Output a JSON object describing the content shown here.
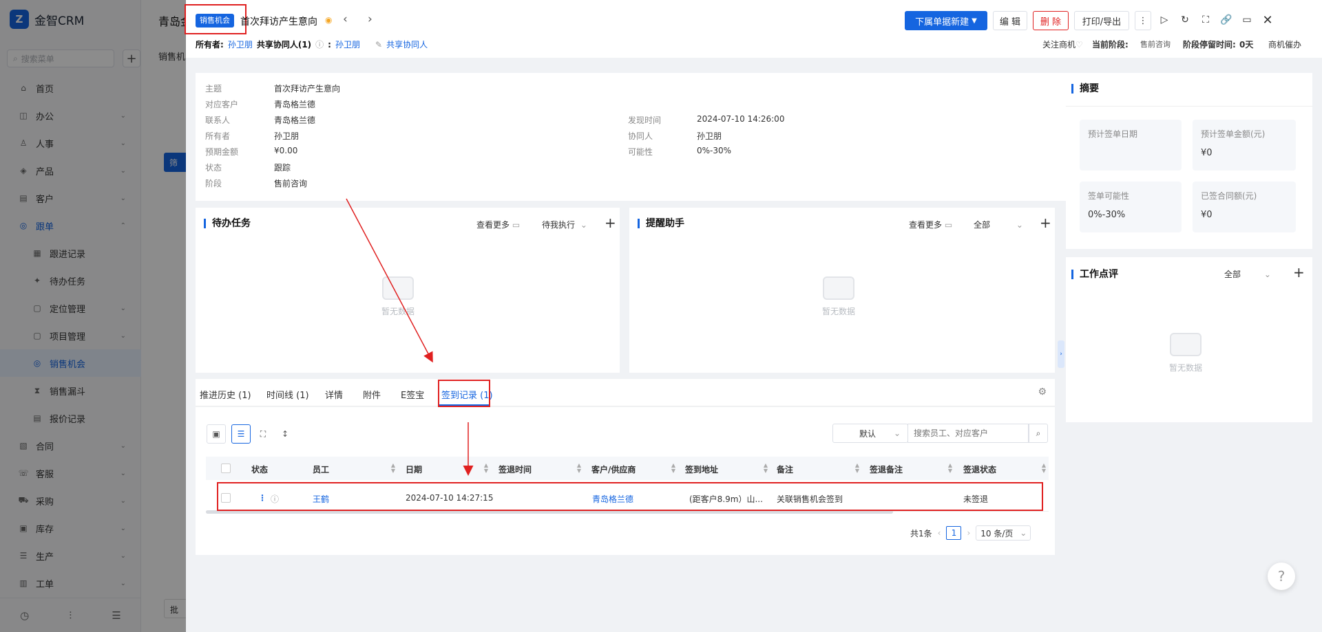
{
  "app": {
    "name": "金智CRM",
    "search_placeholder": "搜索菜单"
  },
  "nav": [
    {
      "label": "首页",
      "icon": "home-icon"
    },
    {
      "label": "办公",
      "icon": "office-icon"
    },
    {
      "label": "人事",
      "icon": "people-icon"
    },
    {
      "label": "产品",
      "icon": "cube-icon"
    },
    {
      "label": "客户",
      "icon": "customer-icon"
    },
    {
      "label": "跟单",
      "icon": "target-icon"
    },
    {
      "label": "跟进记录",
      "icon": "record-icon"
    },
    {
      "label": "待办任务",
      "icon": "pin-icon"
    },
    {
      "label": "定位管理",
      "icon": "location-icon"
    },
    {
      "label": "项目管理",
      "icon": "project-icon"
    },
    {
      "label": "销售机会",
      "icon": "opportunity-icon"
    },
    {
      "label": "销售漏斗",
      "icon": "funnel-icon"
    },
    {
      "label": "报价记录",
      "icon": "quote-icon"
    },
    {
      "label": "合同",
      "icon": "contract-icon"
    },
    {
      "label": "客服",
      "icon": "service-icon"
    },
    {
      "label": "采购",
      "icon": "purchase-icon"
    },
    {
      "label": "库存",
      "icon": "inventory-icon"
    },
    {
      "label": "生产",
      "icon": "production-icon"
    },
    {
      "label": "工单",
      "icon": "ticket-icon"
    }
  ],
  "bg_page": {
    "title": "青岛金",
    "tab": "销售机",
    "filter_btn": "筛",
    "batch_btn": "批"
  },
  "header": {
    "tag": "销售机会",
    "title": "首次拜访产生意向",
    "new_btn": "下属单据新建",
    "edit_btn": "编 辑",
    "delete_btn": "删 除",
    "print_btn": "打印/导出",
    "owner_label": "所有者:",
    "owner": "孙卫朋",
    "shared_label": "共享协同人(1)",
    "shared_colon": ":",
    "shared_name": "孙卫朋",
    "share_action": "共享协同人",
    "follow": "关注商机",
    "stage_label": "当前阶段:",
    "stage": "售前咨询",
    "stay_label": "阶段停留时间:",
    "stay": "0天",
    "urge": "商机催办"
  },
  "info": {
    "left": [
      {
        "label": "主题",
        "value": "首次拜访产生意向",
        "link": false
      },
      {
        "label": "对应客户",
        "value": "青岛格兰德",
        "link": true
      },
      {
        "label": "联系人",
        "value": "青岛格兰德",
        "link": true
      },
      {
        "label": "所有者",
        "value": "孙卫朋",
        "link": false
      },
      {
        "label": "预期金额",
        "value": "¥0.00",
        "link": false
      },
      {
        "label": "状态",
        "value": "跟踪",
        "link": false
      },
      {
        "label": "阶段",
        "value": "售前咨询",
        "link": false
      }
    ],
    "right": [
      {
        "label": "发现时间",
        "value": "2024-07-10 14:26:00"
      },
      {
        "label": "协同人",
        "value": "孙卫朋"
      },
      {
        "label": "可能性",
        "value": "0%-30%"
      }
    ]
  },
  "todo": {
    "title": "待办任务",
    "more": "查看更多",
    "filter": "待我执行",
    "empty": "暂无数据"
  },
  "reminder": {
    "title": "提醒助手",
    "more": "查看更多",
    "filter": "全部",
    "empty": "暂无数据"
  },
  "summary": {
    "title": "摘要",
    "cards": [
      {
        "label": "预计签单日期",
        "value": ""
      },
      {
        "label": "预计签单金额(元)",
        "value": "¥0"
      },
      {
        "label": "签单可能性",
        "value": "0%-30%"
      },
      {
        "label": "已签合同额(元)",
        "value": "¥0"
      }
    ]
  },
  "review": {
    "title": "工作点评",
    "filter": "全部",
    "empty": "暂无数据"
  },
  "tabs": [
    {
      "label": "推进历史 (1)"
    },
    {
      "label": "时间线 (1)"
    },
    {
      "label": "详情"
    },
    {
      "label": "附件"
    },
    {
      "label": "E签宝"
    },
    {
      "label": "签到记录 (1)"
    }
  ],
  "table_tools": {
    "sort_select": "默认",
    "search_placeholder": "搜索员工、对应客户"
  },
  "table": {
    "headers": [
      "状态",
      "员工",
      "日期",
      "签退时间",
      "客户/供应商",
      "签到地址",
      "备注",
      "签退备注",
      "签退状态"
    ],
    "rows": [
      {
        "employee": "王鹤",
        "date": "2024-07-10 14:27:15",
        "checkout_time": "",
        "customer": "青岛格兰德",
        "address": "(距客户8.9m）山...",
        "note": "关联销售机会签到",
        "checkout_note": "",
        "checkout_status": "未签退"
      }
    ]
  },
  "pager": {
    "total": "共1条",
    "page": "1",
    "size": "10 条/页"
  },
  "colors": {
    "accent": "#1565e0",
    "danger": "#e02020",
    "annotation": "#e02020"
  }
}
